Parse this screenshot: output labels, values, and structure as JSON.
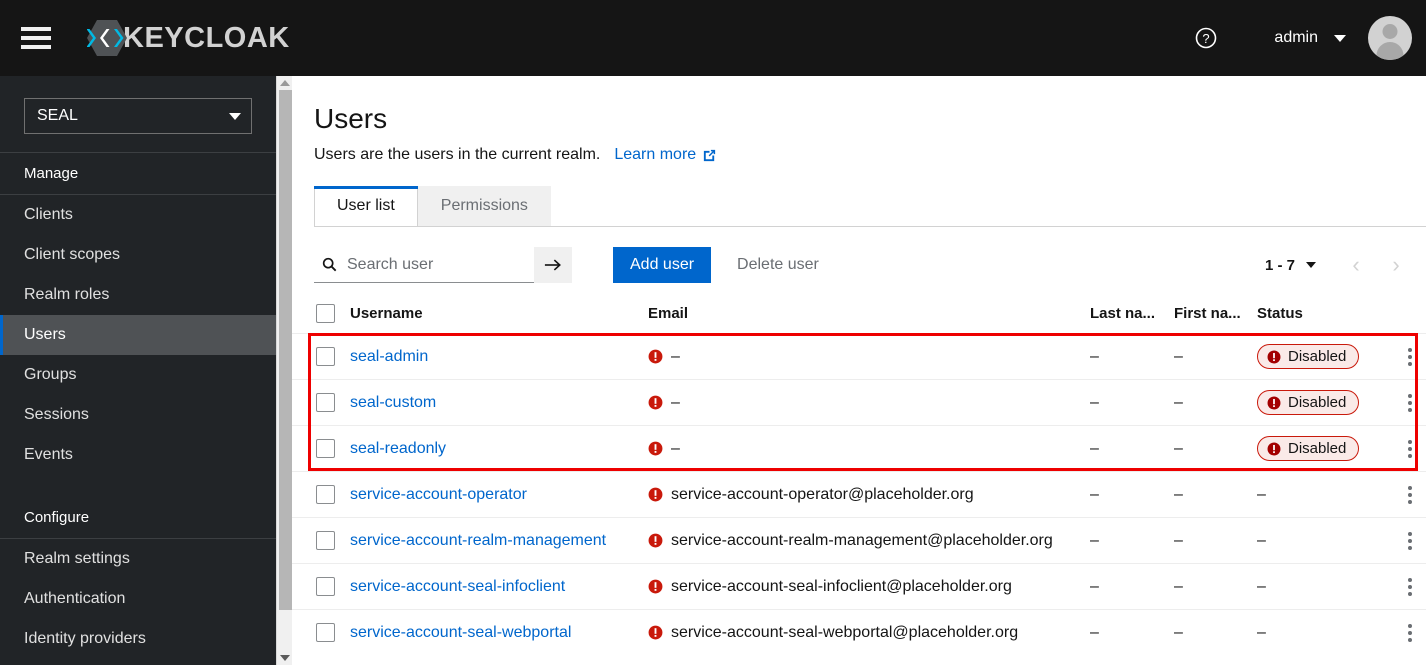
{
  "masthead": {
    "menu_icon": "hamburger-icon",
    "brand_text": "KEYCLOAK",
    "help_icon": "help-circle-icon",
    "username": "admin",
    "avatar_icon": "user-avatar-icon"
  },
  "sidebar": {
    "realm_selector": {
      "value": "SEAL",
      "caret_icon": "caret-down-icon"
    },
    "groups": [
      {
        "title": "Manage",
        "items": [
          {
            "label": "Clients",
            "active": false
          },
          {
            "label": "Client scopes",
            "active": false
          },
          {
            "label": "Realm roles",
            "active": false
          },
          {
            "label": "Users",
            "active": true
          },
          {
            "label": "Groups",
            "active": false
          },
          {
            "label": "Sessions",
            "active": false
          },
          {
            "label": "Events",
            "active": false
          }
        ]
      },
      {
        "title": "Configure",
        "items": [
          {
            "label": "Realm settings",
            "active": false
          },
          {
            "label": "Authentication",
            "active": false
          },
          {
            "label": "Identity providers",
            "active": false
          }
        ]
      }
    ]
  },
  "page": {
    "title": "Users",
    "description": "Users are the users in the current realm.",
    "learn_more": "Learn more",
    "external_link_icon": "external-link-icon"
  },
  "tabs": [
    {
      "label": "User list",
      "active": true
    },
    {
      "label": "Permissions",
      "active": false
    }
  ],
  "toolbar": {
    "search_placeholder": "Search user",
    "search_value": "",
    "search_icon": "search-icon",
    "search_go_icon": "arrow-right-icon",
    "add_user_label": "Add user",
    "delete_user_label": "Delete user",
    "pagination": {
      "range": "1 - 7",
      "caret_icon": "caret-down-icon",
      "prev_icon": "chevron-left-icon",
      "next_icon": "chevron-right-icon"
    }
  },
  "table": {
    "columns": [
      "Username",
      "Email",
      "Last na...",
      "First na...",
      "Status"
    ],
    "rows": [
      {
        "username": "seal-admin",
        "email": "–",
        "email_warning": true,
        "last_name": "–",
        "first_name": "–",
        "status": "Disabled",
        "status_type": "disabled",
        "highlighted": true
      },
      {
        "username": "seal-custom",
        "email": "–",
        "email_warning": true,
        "last_name": "–",
        "first_name": "–",
        "status": "Disabled",
        "status_type": "disabled",
        "highlighted": true
      },
      {
        "username": "seal-readonly",
        "email": "–",
        "email_warning": true,
        "last_name": "–",
        "first_name": "–",
        "status": "Disabled",
        "status_type": "disabled",
        "highlighted": true
      },
      {
        "username": "service-account-operator",
        "email": "service-account-operator@placeholder.org",
        "email_warning": true,
        "last_name": "–",
        "first_name": "–",
        "status": "–",
        "status_type": "none",
        "highlighted": false
      },
      {
        "username": "service-account-realm-management",
        "email": "service-account-realm-management@placeholder.org",
        "email_warning": true,
        "last_name": "–",
        "first_name": "–",
        "status": "–",
        "status_type": "none",
        "highlighted": false
      },
      {
        "username": "service-account-seal-infoclient",
        "email": "service-account-seal-infoclient@placeholder.org",
        "email_warning": true,
        "last_name": "–",
        "first_name": "–",
        "status": "–",
        "status_type": "none",
        "highlighted": false
      },
      {
        "username": "service-account-seal-webportal",
        "email": "service-account-seal-webportal@placeholder.org",
        "email_warning": true,
        "last_name": "–",
        "first_name": "–",
        "status": "–",
        "status_type": "none",
        "highlighted": false
      }
    ]
  },
  "colors": {
    "accent_blue": "#0066cc",
    "masthead_bg": "#151515",
    "sidebar_bg": "#212427",
    "danger_red": "#c9190b",
    "highlight_red": "#ee0000"
  }
}
